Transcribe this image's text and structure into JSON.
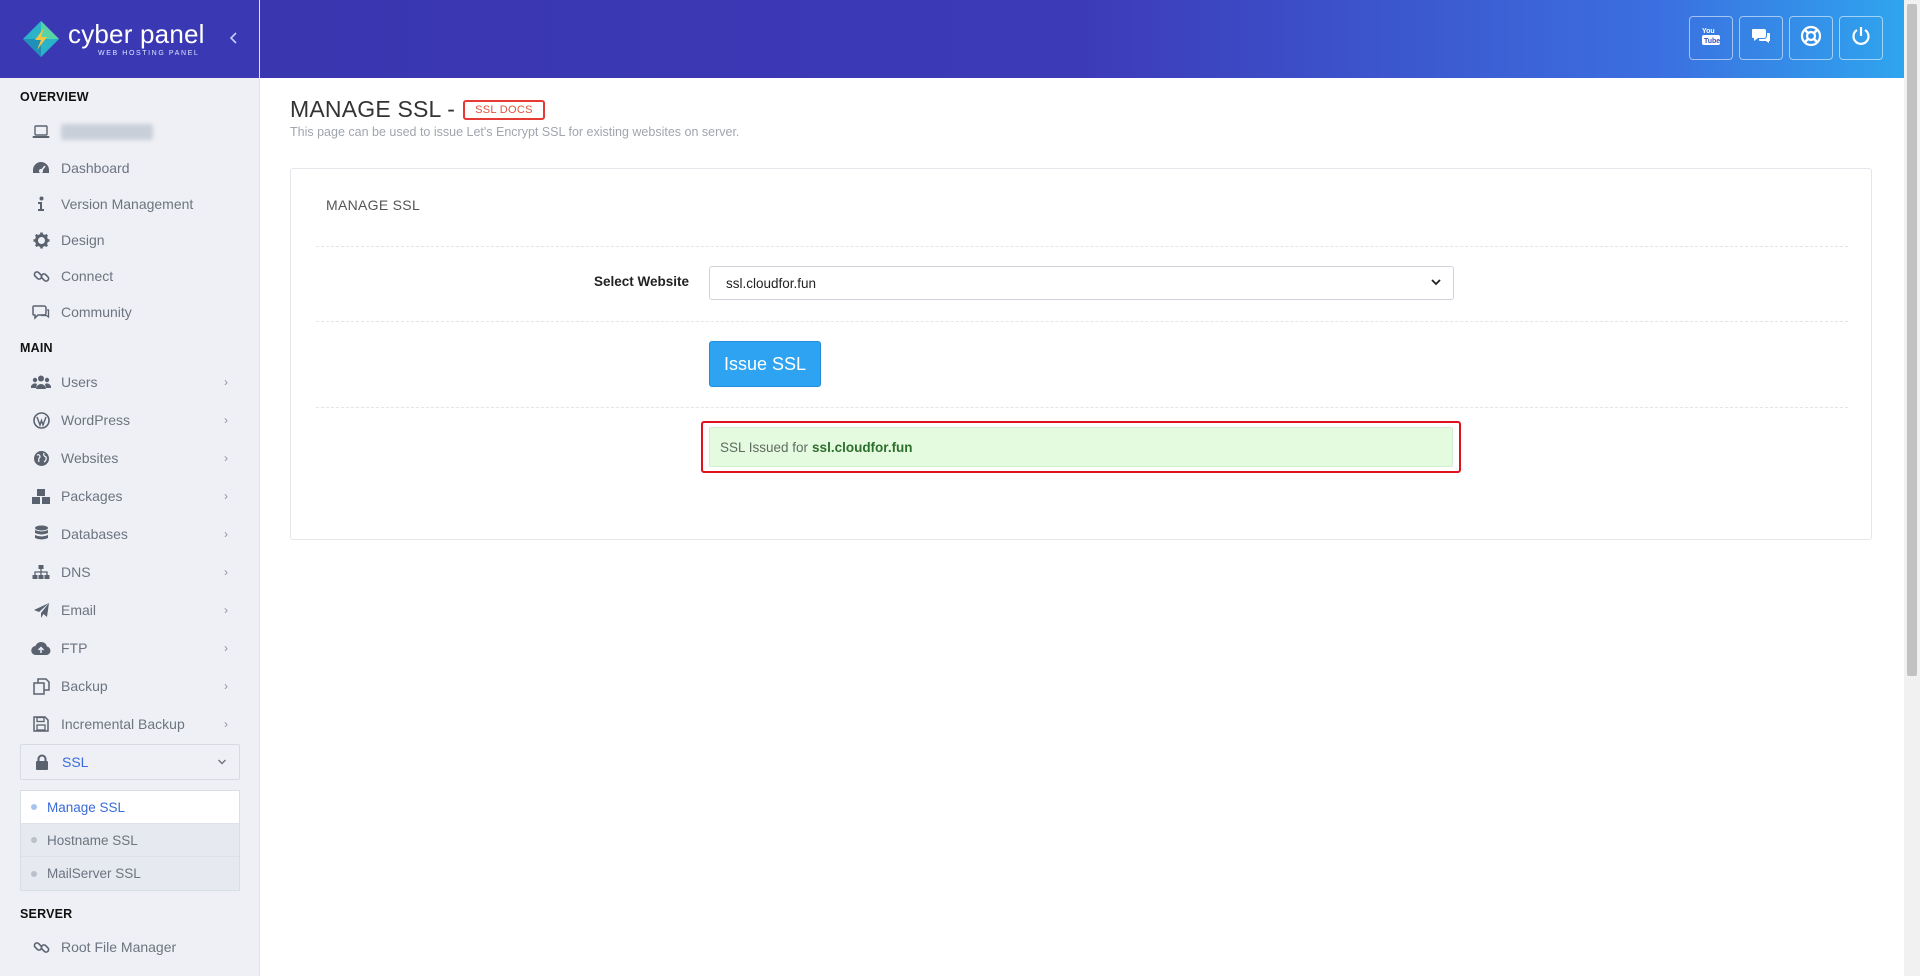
{
  "brand": {
    "name": "cyber panel",
    "tagline": "WEB HOSTING PANEL"
  },
  "sidebar": {
    "sections": {
      "overview": "OVERVIEW",
      "main": "MAIN",
      "server": "SERVER"
    },
    "overview_items": [
      {
        "label": "Dashboard",
        "icon": "dashboard-icon"
      },
      {
        "label": "Version Management",
        "icon": "info-icon"
      },
      {
        "label": "Design",
        "icon": "gear-icon"
      },
      {
        "label": "Connect",
        "icon": "link-icon"
      },
      {
        "label": "Community",
        "icon": "chat-icon"
      }
    ],
    "main_items": [
      {
        "label": "Users",
        "icon": "users-icon"
      },
      {
        "label": "WordPress",
        "icon": "wordpress-icon"
      },
      {
        "label": "Websites",
        "icon": "globe-icon"
      },
      {
        "label": "Packages",
        "icon": "cubes-icon"
      },
      {
        "label": "Databases",
        "icon": "database-icon"
      },
      {
        "label": "DNS",
        "icon": "sitemap-icon"
      },
      {
        "label": "Email",
        "icon": "paper-plane-icon"
      },
      {
        "label": "FTP",
        "icon": "cloud-upload-icon"
      },
      {
        "label": "Backup",
        "icon": "copy-icon"
      },
      {
        "label": "Incremental Backup",
        "icon": "save-icon"
      },
      {
        "label": "SSL",
        "icon": "lock-icon"
      }
    ],
    "ssl_submenu": [
      "Manage SSL",
      "Hostname SSL",
      "MailServer SSL"
    ],
    "server_items": [
      {
        "label": "Root File Manager",
        "icon": "link-icon"
      }
    ]
  },
  "topbar": {
    "buttons": [
      "youtube-icon",
      "chat-icon",
      "support-icon",
      "power-icon"
    ]
  },
  "page": {
    "title": "MANAGE SSL -",
    "docs_badge": "SSL DOCS",
    "description": "This page can be used to issue Let's Encrypt SSL for existing websites on server."
  },
  "panel": {
    "title": "MANAGE SSL",
    "select_label": "Select Website",
    "select_value": "ssl.cloudfor.fun",
    "issue_button": "Issue SSL",
    "alert_prefix": "SSL Issued for",
    "alert_domain": "ssl.cloudfor.fun"
  },
  "colors": {
    "accent": "#2ea3f2",
    "header": "#3a39b3",
    "alert_bg": "#e5fbe0",
    "highlight_border": "#e0121b"
  }
}
